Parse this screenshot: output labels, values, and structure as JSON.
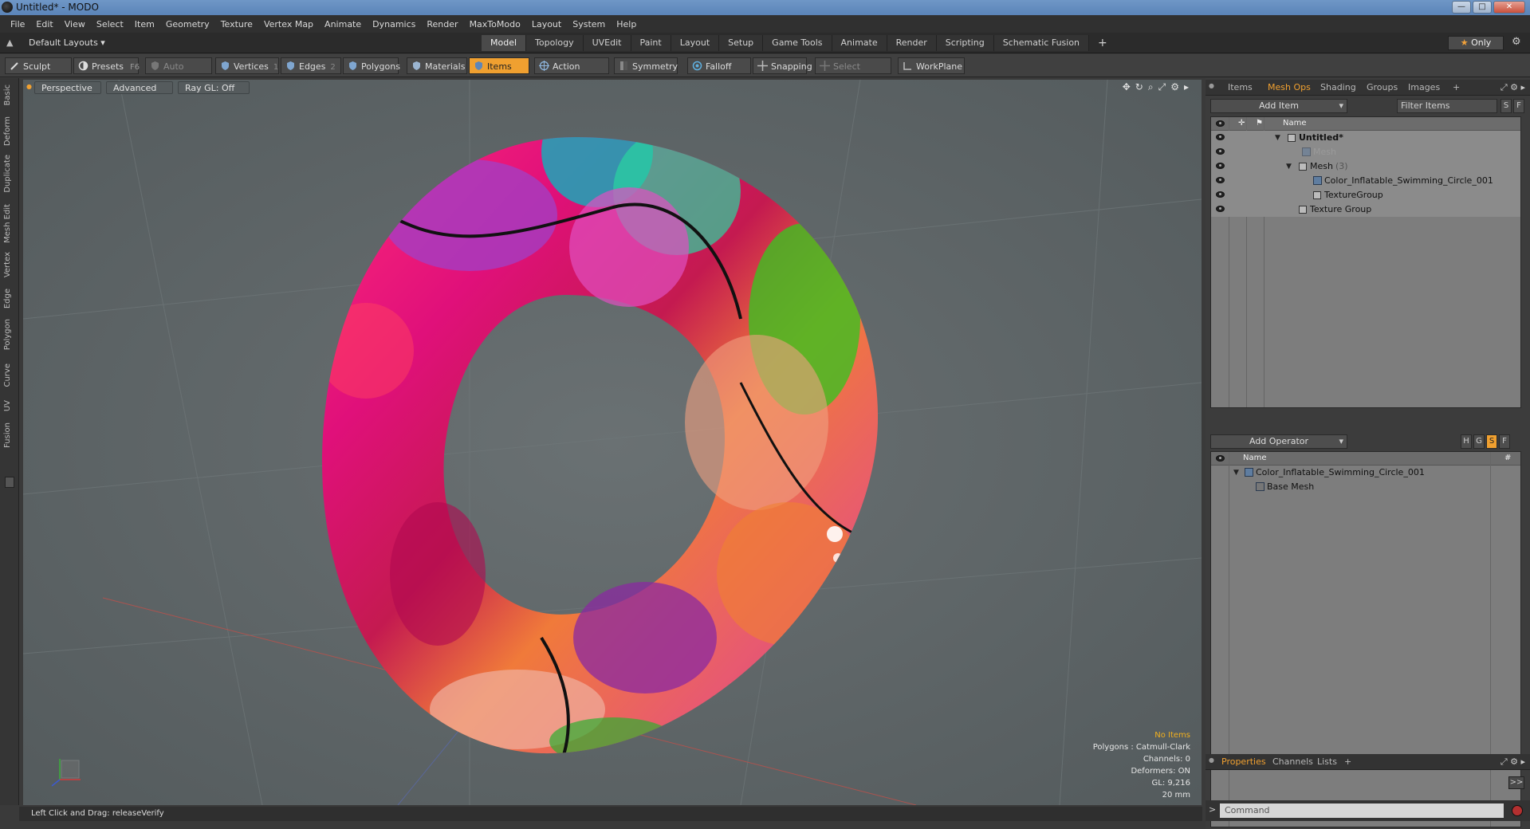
{
  "window": {
    "title": "Untitled* - MODO"
  },
  "menu": [
    "File",
    "Edit",
    "View",
    "Select",
    "Item",
    "Geometry",
    "Texture",
    "Vertex Map",
    "Animate",
    "Dynamics",
    "Render",
    "MaxToModo",
    "Layout",
    "System",
    "Help"
  ],
  "layout": {
    "selector": "Default Layouts ▾",
    "only_label": "Only"
  },
  "tabs": [
    "Model",
    "Topology",
    "UVEdit",
    "Paint",
    "Layout",
    "Setup",
    "Game Tools",
    "Animate",
    "Render",
    "Scripting",
    "Schematic Fusion"
  ],
  "active_tab": "Model",
  "toolbar": {
    "sculpt": "Sculpt",
    "presets": "Presets",
    "presets_key": "F6",
    "auto_select": "Auto Select",
    "vertices": "Vertices",
    "vertices_count": "1",
    "edges": "Edges",
    "edges_count": "2",
    "polygons": "Polygons",
    "materials": "Materials",
    "items": "Items",
    "action_center": "Action Center",
    "symmetry": "Symmetry",
    "falloff": "Falloff",
    "snapping": "Snapping",
    "select_through": "Select Through",
    "workplane": "WorkPlane"
  },
  "left_tabs": [
    "Basic",
    "Deform",
    "Duplicate",
    "Mesh Edit",
    "Vertex",
    "Edge",
    "Polygon",
    "Curve",
    "UV",
    "Fusion"
  ],
  "viewport": {
    "perspective": "Perspective",
    "advanced": "Advanced",
    "raygl": "Ray GL: Off",
    "info": {
      "no_items": "No Items",
      "polygons": "Polygons : Catmull-Clark",
      "channels": "Channels: 0",
      "deformers": "Deformers: ON",
      "gl": "GL: 9,216",
      "size": "20 mm"
    }
  },
  "status": {
    "text": "Left Click and Drag:   releaseVerify"
  },
  "panel_top": {
    "tabs": [
      "Items",
      "Mesh Ops",
      "Shading",
      "Groups",
      "Images"
    ],
    "active_tab": "Mesh Ops",
    "add_item": "Add Item",
    "filter": "Filter Items",
    "s_btn": "S",
    "f_btn": "F",
    "name_header": "Name",
    "rows": [
      {
        "label": "Untitled*",
        "indent": 0
      },
      {
        "label": "Mesh",
        "indent": 1
      },
      {
        "label": "Mesh",
        "count": "(3)",
        "indent": 1
      },
      {
        "label": "Color_Inflatable_Swimming_Circle_001",
        "indent": 2
      },
      {
        "label": "TextureGroup",
        "indent": 2
      },
      {
        "label": "Texture Group",
        "indent": 1
      }
    ]
  },
  "panel_mid": {
    "add_operator": "Add Operator",
    "h_btn": "H",
    "g_btn": "G",
    "s_btn": "S",
    "f_btn": "F",
    "name_header": "Name",
    "hash_header": "#",
    "rows": [
      {
        "label": "Color_Inflatable_Swimming_Circle_001"
      },
      {
        "label": "Base Mesh"
      }
    ]
  },
  "panel_bottom": {
    "tabs": [
      "Properties",
      "Channels",
      "Lists"
    ],
    "active_tab": "Properties",
    "expand": ">>"
  },
  "command": {
    "placeholder": "Command"
  },
  "colors": {
    "accent": "#f0a030",
    "viewport_bg": "#5e6668",
    "panel_bg": "#3c3c3c"
  }
}
